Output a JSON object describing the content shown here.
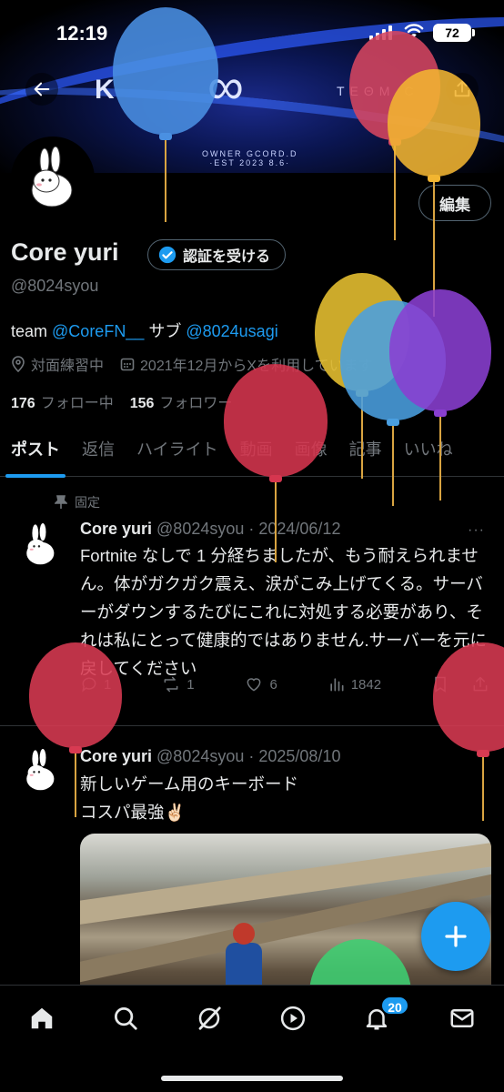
{
  "status_bar": {
    "time": "12:19",
    "battery": "72"
  },
  "banner": {
    "logo_text_k": "K",
    "logo_text_team": "TEΘM C",
    "since_text": "OWNER GCORD.D\n·EST 2023 8.6·"
  },
  "profile": {
    "display_name": "Core yuri",
    "verify_label": "認証を受ける",
    "handle": "@8024syou",
    "edit_label": "編集",
    "bio": {
      "prefix": "team ",
      "link1": "@CoreFN__",
      "middle": " サブ ",
      "link2": "@8024usagi"
    },
    "status_text": "対面練習中",
    "joined_text": "2021年12月からXを利用しています",
    "following_count": "176",
    "following_label": "フォロー中",
    "followers_count": "156",
    "followers_label": "フォロワー"
  },
  "tabs": [
    "ポスト",
    "返信",
    "ハイライト",
    "動画",
    "画像",
    "記事",
    "いいね"
  ],
  "posts": [
    {
      "pinned_label": "固定",
      "name": "Core yuri",
      "meta": " @8024syou · 2024/06/12",
      "text": "Fortnite なしで 1 分経ちましたが、もう耐えられません。体がガクガク震え、涙がこみ上げてくる。サーバーがダウンするたびにこれに対処する必要があり、それは私にとって健康的ではありません.サーバーを元に戻してください",
      "more": "···",
      "replies": "1",
      "reposts": "1",
      "likes": "6",
      "views": "1842"
    },
    {
      "name": "Core yuri",
      "meta": " @8024syou · 2025/08/10",
      "text_line1": "新しいゲーム用のキーボード",
      "text_line2": "コスパ最強✌🏻"
    }
  ],
  "bottom_nav": {
    "items": [
      "home-icon",
      "search-icon",
      "grok-icon",
      "video-icon",
      "notifications-icon",
      "messages-icon"
    ],
    "notification_badge": "20"
  },
  "colors": {
    "accent": "#1d9bf0",
    "muted": "#71767b",
    "text": "#e7e9ea",
    "background": "#000000"
  }
}
